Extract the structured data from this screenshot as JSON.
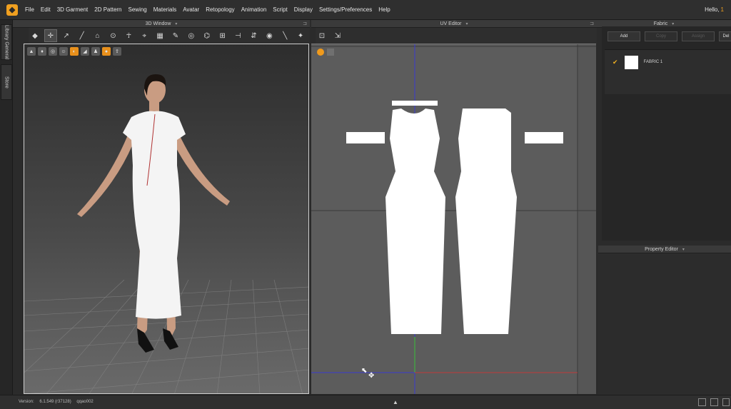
{
  "app": {
    "logo_glyph": "◆",
    "menu": [
      "File",
      "Edit",
      "3D Garment",
      "2D Pattern",
      "Sewing",
      "Materials",
      "Avatar",
      "Retopology",
      "Animation",
      "Script",
      "Display",
      "Settings/Preferences",
      "Help"
    ],
    "greeting": "Hello,",
    "greeting_count": "1"
  },
  "left_tabs": {
    "library": "Library General",
    "store": "Store"
  },
  "panels": {
    "view3d_title": "3D Window",
    "uv_title": "UV Editor",
    "fabric_title": "Fabric",
    "property_title": "Property Editor",
    "dropdown_glyph": "▾",
    "pin_glyph": "⊐"
  },
  "fabric": {
    "buttons": [
      "Add",
      "Copy",
      "Assign",
      "Del"
    ],
    "disabled": [
      false,
      true,
      true,
      false
    ],
    "items": [
      {
        "name": "FABRIC 1",
        "checked": true,
        "color": "#ffffff"
      }
    ]
  },
  "status": {
    "version_label": "Version:",
    "version_value": "6.1.549 (r37128)",
    "build": "qqao002"
  },
  "colors": {
    "accent": "#f0a020",
    "uv_axis_x": "#c03a3a",
    "uv_axis_y": "#3ac03a",
    "uv_axis_blue": "#3a3ad0",
    "pattern_fill": "#ffffff"
  },
  "icons": {
    "view3d_toolbar": [
      "select-mesh-icon",
      "transform-icon",
      "edit-point-icon",
      "segment-icon",
      "fold-icon",
      "tack-icon",
      "avatar-pose-icon",
      "pin-icon",
      "brush-icon",
      "measure-icon",
      "arrangement-icon",
      "steam-icon",
      "shrink-icon",
      "stitch-icon",
      "seam-icon",
      "button-icon",
      "zipper-icon",
      "simulate-icon"
    ],
    "uv_toolbar": [
      "uv-snapshot-icon",
      "uv-export-icon"
    ]
  }
}
